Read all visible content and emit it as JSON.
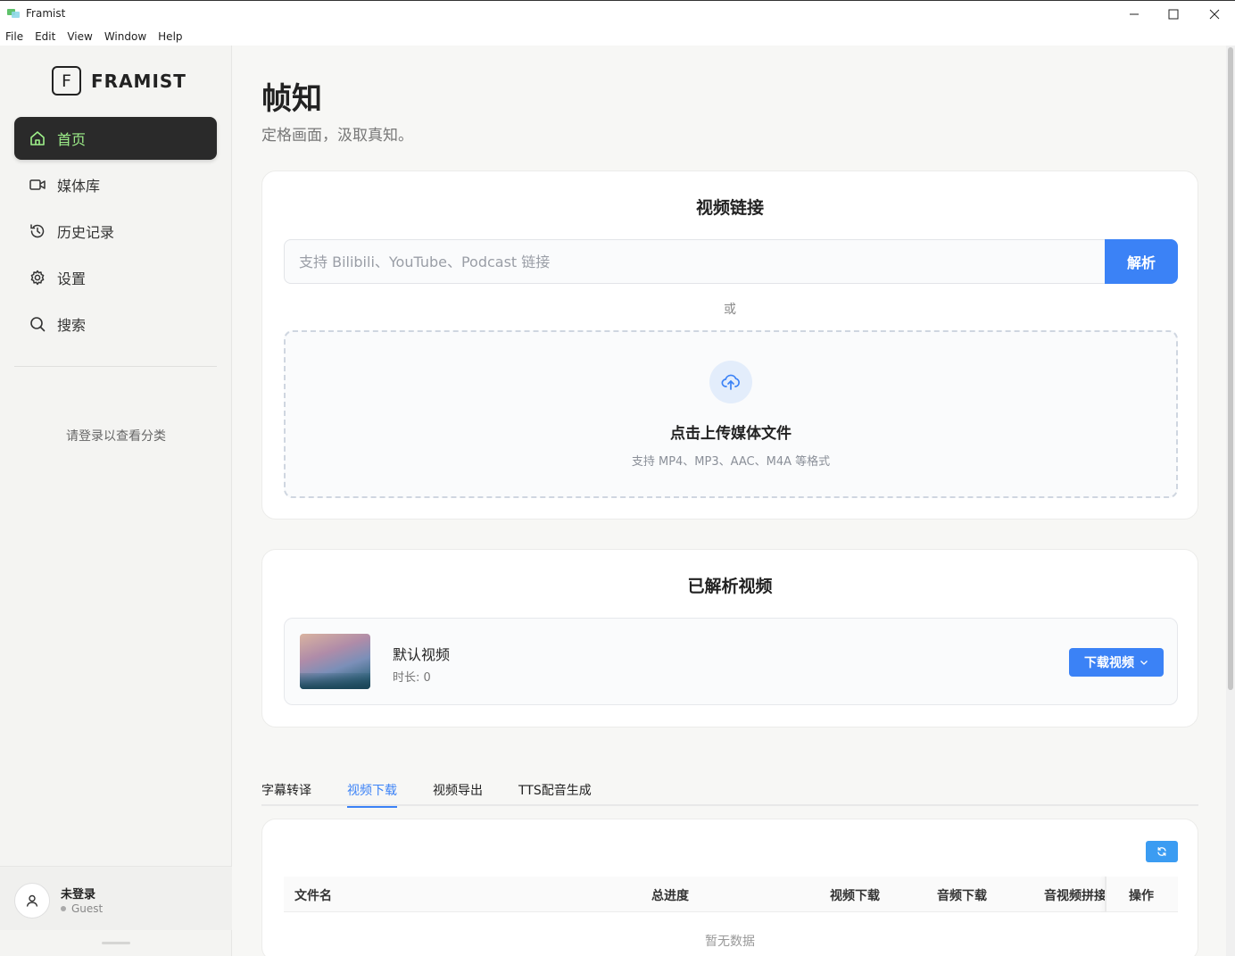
{
  "window": {
    "title": "Framist"
  },
  "menu": [
    "File",
    "Edit",
    "View",
    "Window",
    "Help"
  ],
  "sidebar": {
    "logo_letter": "F",
    "logo_text": "FRAMIST",
    "items": [
      {
        "label": "首页",
        "icon": "home-icon",
        "active": true
      },
      {
        "label": "媒体库",
        "icon": "video-camera-icon"
      },
      {
        "label": "历史记录",
        "icon": "history-icon"
      },
      {
        "label": "设置",
        "icon": "gear-icon"
      },
      {
        "label": "搜索",
        "icon": "search-icon"
      }
    ],
    "login_hint": "请登录以查看分类",
    "user": {
      "name": "未登录",
      "status": "Guest"
    }
  },
  "header": {
    "title": "帧知",
    "subtitle": "定格画面，汲取真知。"
  },
  "link_card": {
    "title": "视频链接",
    "placeholder": "支持 Bilibili、YouTube、Podcast 链接",
    "parse_label": "解析",
    "or_text": "或",
    "upload_title": "点击上传媒体文件",
    "upload_sub": "支持 MP4、MP3、AAC、M4A 等格式"
  },
  "parsed_card": {
    "title": "已解析视频",
    "video": {
      "name": "默认视频",
      "duration": "时长: 0"
    },
    "download_label": "下载视频"
  },
  "tabs": [
    "字幕转译",
    "视频下载",
    "视频导出",
    "TTS配音生成"
  ],
  "active_tab": 1,
  "table": {
    "columns": [
      "文件名",
      "总进度",
      "视频下载",
      "音频下载",
      "音视频拼接",
      "操作"
    ],
    "empty_text": "暂无数据"
  },
  "colors": {
    "accent": "#3b82f6",
    "nav_active_bg": "#2a2a2a",
    "nav_active_fg": "#9ef08a"
  }
}
